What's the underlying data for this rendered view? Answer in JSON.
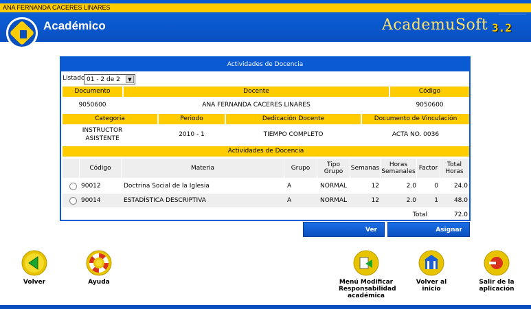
{
  "header": {
    "user_name": "ANA FERNANDA CACERES LINARES",
    "app_title": "Académico",
    "brand": "AcademuSoft",
    "brand_version": "3.2"
  },
  "panel": {
    "title": "Actividades de Docencia",
    "listado_label": "Listado",
    "listado_value": "01 - 2 de 2"
  },
  "docente": {
    "headers": {
      "documento": "Documento",
      "docente": "Docente",
      "codigo": "Código"
    },
    "documento": "9050600",
    "nombre": "ANA FERNANDA CACERES LINARES",
    "codigo": "9050600"
  },
  "vinculacion": {
    "headers": {
      "categoria": "Categoria",
      "periodo": "Periodo",
      "dedicacion": "Dedicación Docente",
      "documento": "Documento de Vinculación"
    },
    "categoria": "INSTRUCTOR ASISTENTE",
    "periodo": "2010 - 1",
    "dedicacion": "TIEMPO COMPLETO",
    "documento": "ACTA NO. 0036"
  },
  "actividades": {
    "section_title": "Actividades de Docencia",
    "columns": {
      "codigo": "Código",
      "materia": "Materia",
      "grupo": "Grupo",
      "tipo_grupo": "Tipo Grupo",
      "semanas": "Semanas",
      "horas_semanales": "Horas Semanales",
      "factor": "Factor",
      "total_horas": "Total Horas"
    },
    "rows": [
      {
        "codigo": "90012",
        "materia": "Doctrina Social de la Iglesia",
        "grupo": "A",
        "tipo_grupo": "NORMAL",
        "semanas": "12",
        "horas_semanales": "2.0",
        "factor": "0",
        "total_horas": "24.0"
      },
      {
        "codigo": "90014",
        "materia": "ESTADÍSTICA DESCRIPTIVA",
        "grupo": "A",
        "tipo_grupo": "NORMAL",
        "semanas": "12",
        "horas_semanales": "2.0",
        "factor": "1",
        "total_horas": "48.0"
      }
    ],
    "total_label": "Total",
    "total_value": "72.0"
  },
  "actions": {
    "ver": "Ver",
    "asignar": "Asignar"
  },
  "nav": {
    "volver": "Volver",
    "ayuda": "Ayuda",
    "menu_modificar": "Menú Modificar Responsabilidad académica",
    "volver_inicio": "Volver al inicio",
    "salir": "Salir de la aplicación"
  },
  "colors": {
    "primary_blue": "#0a5bd3",
    "accent_yellow": "#ffcc00",
    "row_gray": "#eeeeee"
  }
}
